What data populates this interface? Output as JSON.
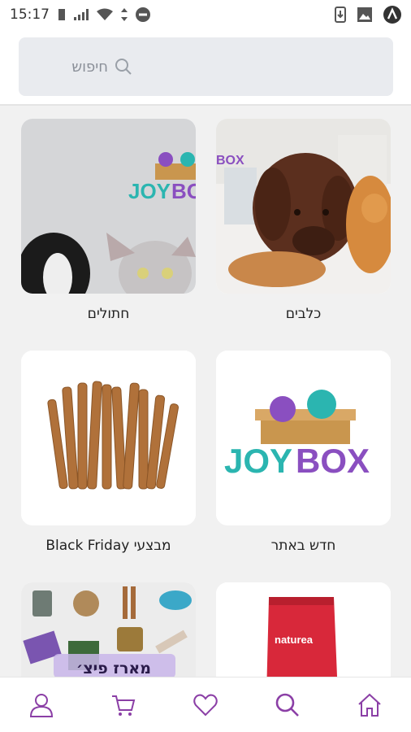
{
  "status_bar": {
    "time": "15:17"
  },
  "search": {
    "placeholder": "חיפוש"
  },
  "categories": [
    {
      "label": "כלבים"
    },
    {
      "label": "חתולים"
    },
    {
      "label": "חדש באתר"
    },
    {
      "label": "Black Friday מבצעי"
    },
    {
      "label": ""
    },
    {
      "label": "מארז פיצ׳"
    }
  ],
  "brand": {
    "logo_text_joy": "JOY",
    "logo_text_box": "BOX",
    "product_brand": "naturea"
  },
  "colors": {
    "accent": "#8b3fa6",
    "teal": "#2bb5b0",
    "purple": "#8a4fc0"
  },
  "nav": {
    "icons": [
      "home-icon",
      "search-icon",
      "heart-icon",
      "cart-icon",
      "user-icon"
    ]
  }
}
